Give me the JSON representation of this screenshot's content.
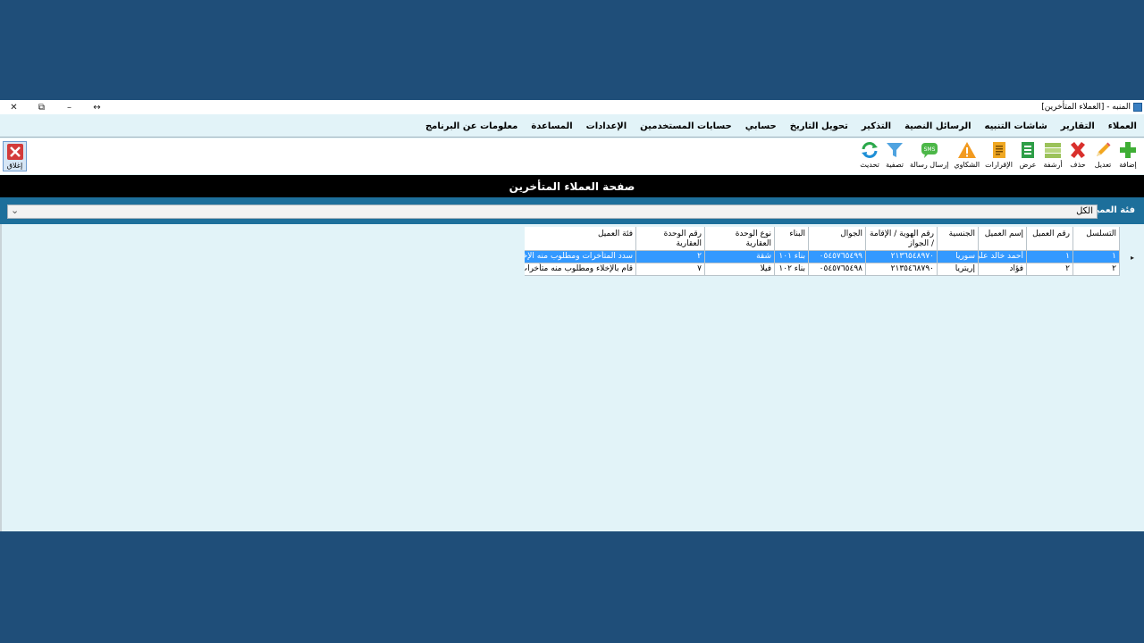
{
  "window": {
    "title": "المنبه - [العملاء المتأخرين]",
    "controls": {
      "close": "✕",
      "restore": "⧉",
      "minimize": "–",
      "resize": "↔"
    }
  },
  "menu": [
    "العملاء",
    "التقارير",
    "شاشات التنبيه",
    "الرسائل النصية",
    "التذكير",
    "تحويل التاريخ",
    "حسابي",
    "حسابات المستخدمين",
    "الإعدادات",
    "المساعدة",
    "معلومات عن البرنامج"
  ],
  "toolbar": [
    {
      "label": "إضافة",
      "icon": "plus-icon"
    },
    {
      "label": "تعديل",
      "icon": "pencil-icon"
    },
    {
      "label": "حذف",
      "icon": "delete-x-icon"
    },
    {
      "label": "أرشفة",
      "icon": "archive-icon"
    },
    {
      "label": "عرض",
      "icon": "spreadsheet-icon"
    },
    {
      "label": "الإقرارات",
      "icon": "document-icon"
    },
    {
      "label": "الشكاوي",
      "icon": "warning-icon"
    },
    {
      "label": "إرسال رسالة",
      "icon": "sms-icon"
    },
    {
      "label": "تصفية",
      "icon": "filter-icon"
    },
    {
      "label": "تحديث",
      "icon": "refresh-icon"
    }
  ],
  "close_tool": {
    "label": "إغلاق",
    "icon": "close-window-icon"
  },
  "page_header": "صفحة العملاء المتأخرين",
  "filter": {
    "label": "فئة العميل",
    "value": "الكل"
  },
  "table": {
    "columns": [
      "التسلسل",
      "رقم العميل",
      "إسم العميل",
      "الجنسية",
      "رقم الهوية / الإقامة / الجواز",
      "الجوال",
      "البناء",
      "نوع الوحدة العقارية",
      "رقم الوحدة العقارية",
      "فئة العميل"
    ],
    "rows": [
      [
        "١",
        "١",
        "أحمد خالد علي",
        "سوريا",
        "٢١٣٦٥٤٨٩٧٠",
        "٠٥٤٥٧٦٥٤٩٩",
        "بناء ١٠١",
        "شقة",
        "٢",
        "سدد المتأخرات ومطلوب منه الإخلاء"
      ],
      [
        "٢",
        "٢",
        "فؤاد",
        "إريتريا",
        "٢١٣٥٤٦٨٧٩٠",
        "٠٥٤٥٧٦٥٤٩٨",
        "بناء ١٠٢",
        "فيلا",
        "٧",
        "قام بالإخلاء ومطلوب منه متأخرات"
      ]
    ],
    "selected_row": 0,
    "row_indicator": "▸"
  },
  "colors": {
    "desktop": "#1f4e79",
    "window_bg": "#e2f3f8",
    "filter_bar": "#1d6f9b",
    "selection": "#3399ff"
  }
}
